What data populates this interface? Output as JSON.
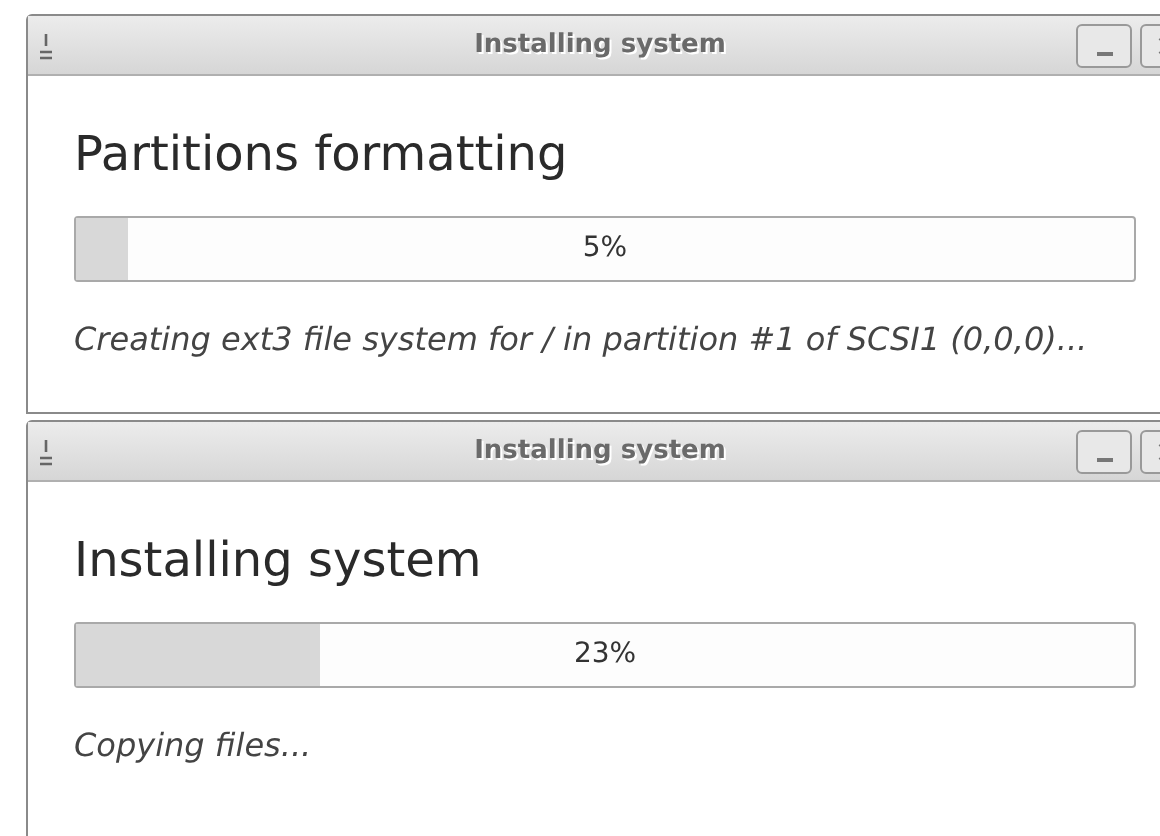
{
  "windows": [
    {
      "title": "Installing system",
      "heading": "Partitions formatting",
      "progress": {
        "level": 0.05,
        "reading": "5%"
      },
      "status": "Creating ext3 file system for / in partition #1 of SCSI1 (0,0,0)..."
    },
    {
      "title": "Installing system",
      "heading": "Installing system",
      "progress": {
        "level": 0.23,
        "reading": "23%"
      },
      "status": "Copying files..."
    }
  ]
}
